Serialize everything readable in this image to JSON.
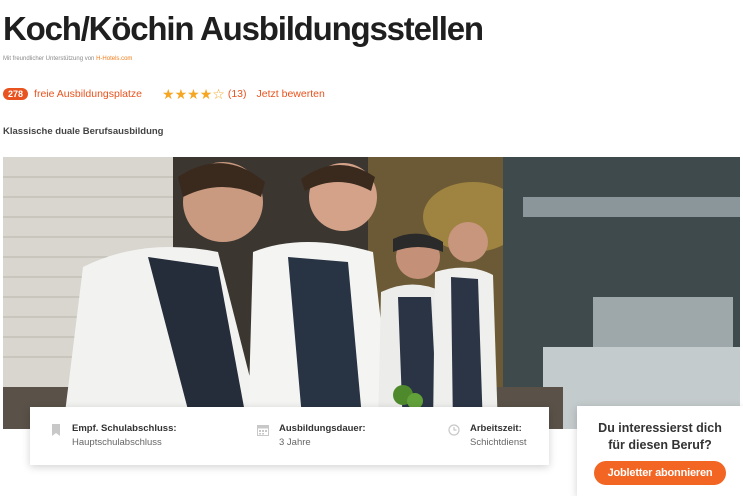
{
  "page": {
    "title": "Koch/Köchin Ausbildungsstellen",
    "sponsor_prefix": "Mit freundlicher Unterstützung von",
    "sponsor_name": "H-Hotels.com"
  },
  "meta": {
    "count": "278",
    "free_places_label": "freie Ausbildungsplatze",
    "rating_stars": 4,
    "rating_max": 5,
    "rating_count": "(13)",
    "rate_link": "Jetzt bewerten"
  },
  "training_type": "Klassische duale Berufsausbildung",
  "hero_image": {
    "subject": "four-cooks-preparing-food-in-kitchen"
  },
  "info": {
    "school": {
      "icon": "bookmark-icon",
      "label": "Empf. Schulabschluss:",
      "value": "Hauptschulabschluss"
    },
    "duration": {
      "icon": "calendar-icon",
      "label": "Ausbildungsdauer:",
      "value": "3 Jahre"
    },
    "worktime": {
      "icon": "clock-icon",
      "label": "Arbeitszeit:",
      "value": "Schichtdienst"
    }
  },
  "cta": {
    "title_line1": "Du interessierst dich",
    "title_line2": "für diesen Beruf?",
    "button": "Jobletter abonnieren"
  },
  "colors": {
    "accent": "#e8531f",
    "button": "#f26522",
    "star": "#f5a623"
  }
}
